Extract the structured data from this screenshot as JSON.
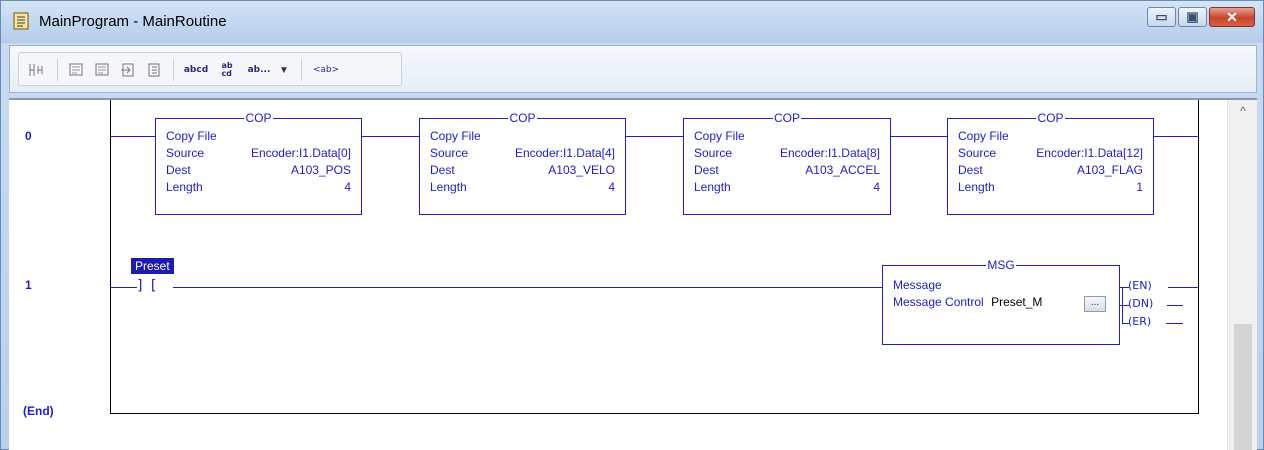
{
  "window": {
    "title": "MainProgram - MainRoutine",
    "buttons": {
      "minimize": "▭",
      "maximize": "▣",
      "close": "✕"
    }
  },
  "toolbar": {
    "text_buttons": [
      "abcd",
      "ab\ncd",
      "ab...",
      "<ab>"
    ],
    "dropdown_glyph": "▼"
  },
  "ladder": {
    "rungs": [
      {
        "number": "0"
      },
      {
        "number": "1"
      },
      {
        "number": "(End)"
      }
    ],
    "cop_blocks": [
      {
        "mnemonic": "COP",
        "name": "Copy File",
        "source_label": "Source",
        "source": "Encoder:I1.Data[0]",
        "dest_label": "Dest",
        "dest": "A103_POS",
        "length_label": "Length",
        "length": "4"
      },
      {
        "mnemonic": "COP",
        "name": "Copy File",
        "source_label": "Source",
        "source": "Encoder:I1.Data[4]",
        "dest_label": "Dest",
        "dest": "A103_VELO",
        "length_label": "Length",
        "length": "4"
      },
      {
        "mnemonic": "COP",
        "name": "Copy File",
        "source_label": "Source",
        "source": "Encoder:I1.Data[8]",
        "dest_label": "Dest",
        "dest": "A103_ACCEL",
        "length_label": "Length",
        "length": "4"
      },
      {
        "mnemonic": "COP",
        "name": "Copy File",
        "source_label": "Source",
        "source": "Encoder:I1.Data[12]",
        "dest_label": "Dest",
        "dest": "A103_FLAG",
        "length_label": "Length",
        "length": "1"
      }
    ],
    "contact": {
      "tag": "Preset",
      "symbol": "] ["
    },
    "msg_block": {
      "mnemonic": "MSG",
      "name": "Message",
      "control_label": "Message Control",
      "control": "Preset_M",
      "browse": "...",
      "coils": [
        "(EN)",
        "(DN)",
        "(ER)"
      ]
    }
  },
  "colors": {
    "ladder_blue": "#2020c0",
    "tag_highlight": "#1d1bb0",
    "title_bar": "#c2d7f0",
    "close_button": "#c7442c"
  }
}
